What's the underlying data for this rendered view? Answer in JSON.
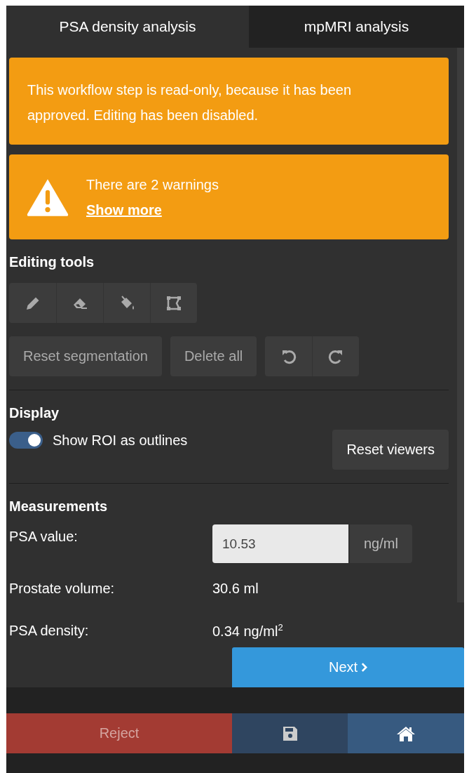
{
  "tabs": [
    {
      "label": "PSA density analysis",
      "selected": true
    },
    {
      "label": "mpMRI analysis",
      "selected": false
    }
  ],
  "read_only_alert": {
    "text": "This workflow step is read-only, because it has been approved. Editing has been disabled."
  },
  "warning_alert": {
    "text": "There are 2 warnings",
    "link": "Show more"
  },
  "editing_tools": {
    "title": "Editing tools",
    "tools": [
      {
        "kind": "pencil",
        "disabled": true
      },
      {
        "kind": "eraser",
        "disabled": true
      },
      {
        "kind": "fill",
        "disabled": true
      },
      {
        "kind": "polygon",
        "disabled": true
      }
    ],
    "actions": [
      {
        "label": "Reset segmentation",
        "disabled": true
      },
      {
        "label": "Delete all",
        "disabled": true
      }
    ],
    "history": [
      {
        "kind": "undo",
        "disabled": true
      },
      {
        "kind": "redo",
        "disabled": true
      }
    ]
  },
  "display": {
    "title": "Display",
    "toggle": {
      "label": "Show ROI as outlines",
      "on": true
    },
    "reset_button": "Reset viewers"
  },
  "measurements": {
    "title": "Measurements",
    "rows": [
      {
        "kind": "input",
        "label": "PSA value:",
        "value": "10.53",
        "unit": "ng/ml"
      },
      {
        "kind": "text",
        "label": "Prostate volume:",
        "value": "30.6 ml"
      },
      {
        "kind": "text",
        "label": "PSA density:",
        "value": "0.34 ng/ml$^{2}$"
      }
    ]
  },
  "next_button": "Next",
  "footer": [
    {
      "kind": "reject",
      "label": "Reject"
    },
    {
      "kind": "save"
    },
    {
      "kind": "home"
    }
  ]
}
